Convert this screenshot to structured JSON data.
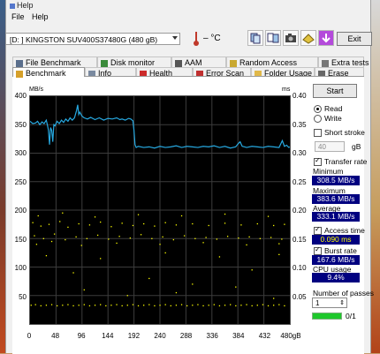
{
  "window": {
    "title": "Help"
  },
  "menu": {
    "file": "File",
    "help": "Help"
  },
  "toolbar": {
    "drive": "[D: ] KINGSTON SUV400S37480G (480 gB)",
    "temperature": "– °C",
    "exit_label": "Exit",
    "icons": [
      "copy-icon",
      "copy-text-icon",
      "camera-icon",
      "save-icon",
      "download-icon"
    ]
  },
  "tabs": {
    "row1": [
      "File Benchmark",
      "Disk monitor",
      "AAM",
      "Random Access",
      "Extra tests"
    ],
    "row2": [
      "Benchmark",
      "Info",
      "Health",
      "Error Scan",
      "Folder Usage",
      "Erase"
    ]
  },
  "colors": {
    "accent_value_bg": "#000080",
    "read_line": "#27a9e1",
    "access_dots": "#ffff00",
    "progress": "#1ec82b"
  },
  "chart_data": {
    "type": "line",
    "ylabel_left": "MB/s",
    "ylabel_right": "ms",
    "y_left_ticks": [
      "400",
      "350",
      "300",
      "250",
      "200",
      "150",
      "100",
      "50"
    ],
    "y_right_ticks": [
      "0.40",
      "0.35",
      "0.30",
      "0.25",
      "0.20",
      "0.15",
      "0.10",
      "0.05"
    ],
    "x_ticks": [
      "0",
      "48",
      "96",
      "144",
      "192",
      "240",
      "288",
      "336",
      "384",
      "432",
      "480gB"
    ],
    "xlim": [
      0,
      480
    ],
    "ylim_left": [
      0,
      400
    ],
    "ylim_right": [
      0,
      0.4
    ],
    "grid": true,
    "series": [
      {
        "name": "Read",
        "x": [
          0,
          5,
          10,
          14,
          18,
          22,
          26,
          30,
          32,
          34,
          36,
          38,
          40,
          42,
          44,
          46,
          50,
          54,
          58,
          62,
          66,
          70,
          74,
          78,
          82,
          86,
          88,
          90,
          92,
          96,
          100,
          106,
          112,
          120,
          128,
          136,
          144,
          152,
          160,
          166,
          170,
          176,
          182,
          186,
          190,
          192,
          194,
          196,
          200,
          210,
          220,
          230,
          240,
          250,
          260,
          270,
          280,
          290,
          300,
          310,
          320,
          330,
          340,
          350,
          360,
          370,
          380,
          384,
          388,
          392,
          396,
          400,
          410,
          420,
          430,
          440,
          450,
          460,
          466,
          470,
          474,
          478,
          480
        ],
        "y": [
          356,
          352,
          353,
          356,
          350,
          355,
          352,
          358,
          350,
          340,
          315,
          345,
          340,
          320,
          350,
          348,
          356,
          352,
          358,
          354,
          360,
          356,
          362,
          358,
          362,
          375,
          385,
          368,
          372,
          365,
          362,
          360,
          363,
          359,
          362,
          358,
          361,
          360,
          362,
          359,
          360,
          358,
          361,
          360,
          357,
          340,
          315,
          310,
          312,
          310,
          311,
          309,
          312,
          310,
          311,
          313,
          310,
          312,
          311,
          310,
          312,
          311,
          313,
          310,
          312,
          309,
          311,
          316,
          320,
          312,
          311,
          310,
          312,
          311,
          310,
          312,
          311,
          310,
          322,
          312,
          314,
          310,
          311
        ]
      },
      {
        "name": "Access time",
        "points": [
          [
            2,
            0.033
          ],
          [
            10,
            0.034
          ],
          [
            20,
            0.032
          ],
          [
            30,
            0.033
          ],
          [
            40,
            0.034
          ],
          [
            50,
            0.032
          ],
          [
            60,
            0.033
          ],
          [
            70,
            0.034
          ],
          [
            80,
            0.032
          ],
          [
            90,
            0.033
          ],
          [
            100,
            0.034
          ],
          [
            110,
            0.032
          ],
          [
            120,
            0.033
          ],
          [
            130,
            0.034
          ],
          [
            140,
            0.032
          ],
          [
            150,
            0.033
          ],
          [
            160,
            0.034
          ],
          [
            170,
            0.032
          ],
          [
            180,
            0.033
          ],
          [
            190,
            0.034
          ],
          [
            200,
            0.032
          ],
          [
            210,
            0.033
          ],
          [
            220,
            0.034
          ],
          [
            230,
            0.032
          ],
          [
            240,
            0.033
          ],
          [
            250,
            0.034
          ],
          [
            260,
            0.032
          ],
          [
            270,
            0.033
          ],
          [
            280,
            0.034
          ],
          [
            290,
            0.032
          ],
          [
            300,
            0.033
          ],
          [
            310,
            0.034
          ],
          [
            320,
            0.032
          ],
          [
            330,
            0.033
          ],
          [
            340,
            0.034
          ],
          [
            350,
            0.032
          ],
          [
            360,
            0.033
          ],
          [
            370,
            0.034
          ],
          [
            380,
            0.032
          ],
          [
            390,
            0.033
          ],
          [
            400,
            0.034
          ],
          [
            410,
            0.032
          ],
          [
            420,
            0.033
          ],
          [
            430,
            0.034
          ],
          [
            440,
            0.032
          ],
          [
            450,
            0.033
          ],
          [
            460,
            0.034
          ],
          [
            470,
            0.032
          ],
          [
            5,
            0.178
          ],
          [
            20,
            0.172
          ],
          [
            35,
            0.175
          ],
          [
            55,
            0.18
          ],
          [
            70,
            0.17
          ],
          [
            90,
            0.176
          ],
          [
            110,
            0.174
          ],
          [
            130,
            0.179
          ],
          [
            150,
            0.171
          ],
          [
            170,
            0.177
          ],
          [
            190,
            0.173
          ],
          [
            210,
            0.176
          ],
          [
            230,
            0.172
          ],
          [
            250,
            0.178
          ],
          [
            270,
            0.174
          ],
          [
            300,
            0.176
          ],
          [
            330,
            0.173
          ],
          [
            360,
            0.177
          ],
          [
            390,
            0.174
          ],
          [
            420,
            0.176
          ],
          [
            450,
            0.173
          ],
          [
            470,
            0.175
          ],
          [
            8,
            0.155
          ],
          [
            25,
            0.15
          ],
          [
            45,
            0.158
          ],
          [
            65,
            0.148
          ],
          [
            85,
            0.153
          ],
          [
            105,
            0.15
          ],
          [
            125,
            0.156
          ],
          [
            145,
            0.149
          ],
          [
            165,
            0.154
          ],
          [
            185,
            0.151
          ],
          [
            205,
            0.157
          ],
          [
            225,
            0.15
          ],
          [
            245,
            0.153
          ],
          [
            265,
            0.148
          ],
          [
            285,
            0.155
          ],
          [
            305,
            0.15
          ],
          [
            325,
            0.152
          ],
          [
            345,
            0.149
          ],
          [
            365,
            0.154
          ],
          [
            385,
            0.151
          ],
          [
            405,
            0.153
          ],
          [
            425,
            0.15
          ],
          [
            445,
            0.152
          ],
          [
            465,
            0.149
          ],
          [
            15,
            0.19
          ],
          [
            60,
            0.195
          ],
          [
            120,
            0.188
          ],
          [
            200,
            0.192
          ],
          [
            280,
            0.19
          ],
          [
            360,
            0.193
          ],
          [
            440,
            0.189
          ],
          [
            12,
            0.14
          ],
          [
            40,
            0.145
          ],
          [
            95,
            0.138
          ],
          [
            160,
            0.142
          ],
          [
            240,
            0.14
          ],
          [
            320,
            0.143
          ],
          [
            400,
            0.139
          ],
          [
            460,
            0.141
          ],
          [
            30,
            0.12
          ],
          [
            130,
            0.115
          ],
          [
            250,
            0.125
          ],
          [
            350,
            0.118
          ],
          [
            460,
            0.122
          ],
          [
            80,
            0.09
          ],
          [
            220,
            0.08
          ],
          [
            300,
            0.07
          ],
          [
            410,
            0.095
          ],
          [
            100,
            0.06
          ],
          [
            180,
            0.05
          ],
          [
            270,
            0.055
          ],
          [
            380,
            0.065
          ],
          [
            450,
            0.045
          ]
        ]
      }
    ]
  },
  "controls": {
    "start_label": "Start",
    "read_label": "Read",
    "write_label": "Write",
    "short_stroke_label": "Short stroke",
    "short_stroke_value": "40",
    "short_stroke_unit": "gB",
    "transfer_rate_label": "Transfer rate",
    "minimum_label": "Minimum",
    "minimum_value": "308.5 MB/s",
    "maximum_label": "Maximum",
    "maximum_value": "383.6 MB/s",
    "average_label": "Average",
    "average_value": "333.1 MB/s",
    "access_time_label": "Access time",
    "access_time_value": "0.090 ms",
    "burst_rate_label": "Burst rate",
    "burst_rate_value": "167.6 MB/s",
    "cpu_usage_label": "CPU usage",
    "cpu_usage_value": "9.4%",
    "passes_label": "Number of passes",
    "passes_value": "1",
    "passes_progress": "0/1",
    "passes_progress_fraction": 1.0
  }
}
